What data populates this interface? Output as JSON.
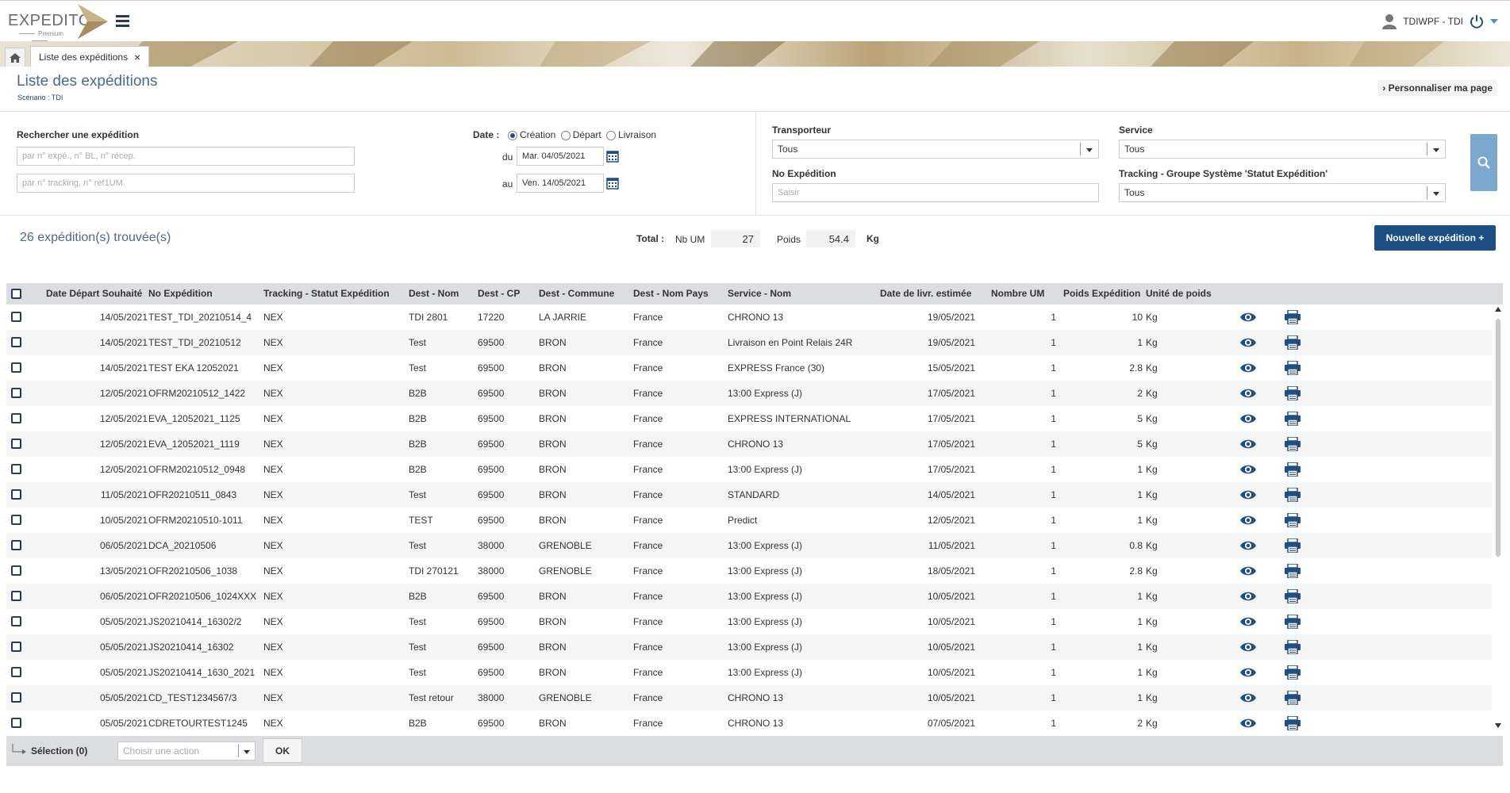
{
  "header": {
    "logo_text": "EXPEDITO",
    "logo_sub": "Premium",
    "user": "TDIWPF - TDI"
  },
  "tabs": {
    "active_label": "Liste des expéditions",
    "close": "×"
  },
  "page": {
    "title": "Liste des expéditions",
    "scenario": "Scénario : TDI",
    "customize": "Personnaliser ma page"
  },
  "search": {
    "label": "Rechercher une expédition",
    "ref_placeholder": "par n° expé., n° BL, n° récep.",
    "tracking_placeholder": "par n° tracking, n° ref1UM",
    "date_label": "Date :",
    "date_options": [
      "Création",
      "Départ",
      "Livraison"
    ],
    "du_label": "du",
    "au_label": "au",
    "date_from": "Mar.  04/05/2021",
    "date_to": "Ven.  14/05/2021",
    "transporteur_label": "Transporteur",
    "transporteur_value": "Tous",
    "service_label": "Service",
    "service_value": "Tous",
    "no_exp_label": "No Expédition",
    "no_exp_placeholder": "Saisir",
    "tracking_group_label": "Tracking - Groupe Système 'Statut Expédition'",
    "tracking_group_value": "Tous"
  },
  "summary": {
    "found": "26 expédition(s) trouvée(s)",
    "total_label": "Total :",
    "nb_um_label": "Nb UM",
    "nb_um_value": "27",
    "poids_label": "Poids",
    "poids_value": "54.4",
    "unit": "Kg",
    "new_button": "Nouvelle expédition +"
  },
  "table": {
    "columns": [
      "Date Départ Souhaité",
      "No Expédition",
      "Tracking - Statut Expédition",
      "Dest - Nom",
      "Dest - CP",
      "Dest - Commune",
      "Dest - Nom Pays",
      "Service - Nom",
      "Date de livr. estimée",
      "Nombre UM",
      "Poids Expédition",
      "Unité de poids"
    ],
    "rows": [
      [
        "14/05/2021",
        "TEST_TDI_20210514_4",
        "NEX",
        "TDI 2801",
        "17220",
        "LA JARRIE",
        "France",
        "CHRONO 13",
        "19/05/2021",
        "1",
        "10",
        "Kg"
      ],
      [
        "14/05/2021",
        "TEST_TDI_20210512",
        "NEX",
        "Test",
        "69500",
        "BRON",
        "France",
        "Livraison en Point Relais 24R",
        "19/05/2021",
        "1",
        "1",
        "Kg"
      ],
      [
        "14/05/2021",
        "TEST EKA 12052021",
        "NEX",
        "Test",
        "69500",
        "BRON",
        "France",
        "EXPRESS France (30)",
        "15/05/2021",
        "1",
        "2.8",
        "Kg"
      ],
      [
        "12/05/2021",
        "OFRM20210512_1422",
        "NEX",
        "B2B",
        "69500",
        "BRON",
        "France",
        "13:00 Express (J)",
        "17/05/2021",
        "1",
        "2",
        "Kg"
      ],
      [
        "12/05/2021",
        "EVA_12052021_1125",
        "NEX",
        "B2B",
        "69500",
        "BRON",
        "France",
        "EXPRESS INTERNATIONAL",
        "17/05/2021",
        "1",
        "5",
        "Kg"
      ],
      [
        "12/05/2021",
        "EVA_12052021_1119",
        "NEX",
        "B2B",
        "69500",
        "BRON",
        "France",
        "CHRONO 13",
        "17/05/2021",
        "1",
        "5",
        "Kg"
      ],
      [
        "12/05/2021",
        "OFRM20210512_0948",
        "NEX",
        "B2B",
        "69500",
        "BRON",
        "France",
        "13:00 Express (J)",
        "17/05/2021",
        "1",
        "1",
        "Kg"
      ],
      [
        "11/05/2021",
        "OFR20210511_0843",
        "NEX",
        "Test",
        "69500",
        "BRON",
        "France",
        "STANDARD",
        "14/05/2021",
        "1",
        "1",
        "Kg"
      ],
      [
        "10/05/2021",
        "OFRM20210510-1011",
        "NEX",
        "TEST",
        "69500",
        "BRON",
        "France",
        "Predict",
        "12/05/2021",
        "1",
        "1",
        "Kg"
      ],
      [
        "06/05/2021",
        "DCA_20210506",
        "NEX",
        "Test",
        "38000",
        "GRENOBLE",
        "France",
        "13:00 Express (J)",
        "11/05/2021",
        "1",
        "0.8",
        "Kg"
      ],
      [
        "13/05/2021",
        "OFR20210506_1038",
        "NEX",
        "TDI 270121",
        "38000",
        "GRENOBLE",
        "France",
        "13:00 Express (J)",
        "18/05/2021",
        "1",
        "2.8",
        "Kg"
      ],
      [
        "06/05/2021",
        "OFR20210506_1024XXX",
        "NEX",
        "B2B",
        "69500",
        "BRON",
        "France",
        "13:00 Express (J)",
        "10/05/2021",
        "1",
        "1",
        "Kg"
      ],
      [
        "05/05/2021",
        "JS20210414_16302/2",
        "NEX",
        "Test",
        "69500",
        "BRON",
        "France",
        "13:00 Express (J)",
        "10/05/2021",
        "1",
        "1",
        "Kg"
      ],
      [
        "05/05/2021",
        "JS20210414_16302",
        "NEX",
        "Test",
        "69500",
        "BRON",
        "France",
        "13:00 Express (J)",
        "10/05/2021",
        "1",
        "1",
        "Kg"
      ],
      [
        "05/05/2021",
        "JS20210414_1630_2021",
        "NEX",
        "Test",
        "69500",
        "BRON",
        "France",
        "13:00 Express (J)",
        "10/05/2021",
        "1",
        "1",
        "Kg"
      ],
      [
        "05/05/2021",
        "CD_TEST1234567/3",
        "NEX",
        "Test retour",
        "38000",
        "GRENOBLE",
        "France",
        "CHRONO 13",
        "10/05/2021",
        "1",
        "1",
        "Kg"
      ],
      [
        "05/05/2021",
        "CDRETOURTEST1245",
        "NEX",
        "B2B",
        "69500",
        "BRON",
        "France",
        "CHRONO 13",
        "07/05/2021",
        "1",
        "2",
        "Kg"
      ]
    ]
  },
  "footer": {
    "selection": "Sélection (0)",
    "action_placeholder": "Choisir une action",
    "ok": "OK"
  },
  "colors": {
    "primary": "#1d4f85",
    "search_button": "#7aa8cf",
    "title": "#4a6a8a",
    "header_row": "#dcdde0"
  }
}
